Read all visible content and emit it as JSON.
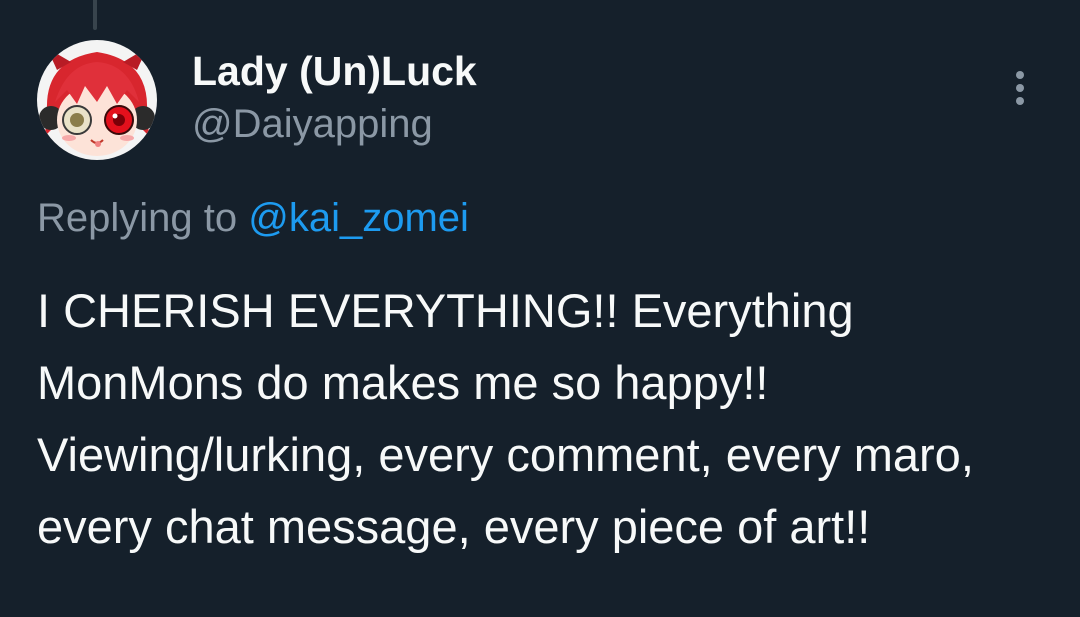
{
  "tweet": {
    "display_name": "Lady (Un)Luck",
    "handle": "@Daiyapping",
    "replying_prefix": "Replying to ",
    "replying_to": "@kai_zomei",
    "text": "I CHERISH EVERYTHING!! Everything MonMons do makes me so happy!! Viewing/lurking, every comment, every maro, every chat message, every piece of art!!",
    "more_icon": "more-vertical-icon"
  },
  "colors": {
    "background": "#15202b",
    "text_primary": "#f7f9f9",
    "text_secondary": "#8b98a5",
    "link": "#1d9bf0"
  }
}
